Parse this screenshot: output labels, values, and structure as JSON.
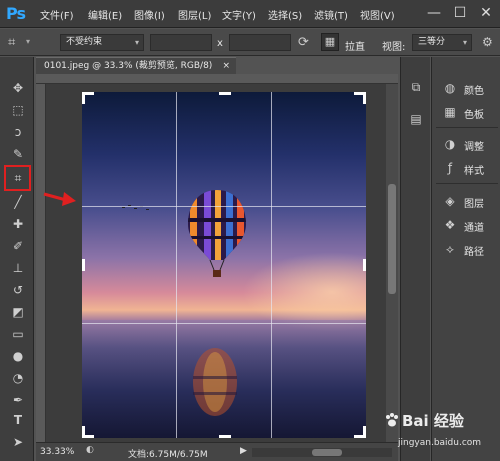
{
  "app": {
    "logo": "Ps"
  },
  "menubar": {
    "items": [
      "文件(F)",
      "编辑(E)",
      "图像(I)",
      "图层(L)",
      "文字(Y)",
      "选择(S)",
      "滤镜(T)",
      "视图(V)"
    ]
  },
  "window_controls": {
    "minimize": "—",
    "maximize": "☐",
    "close": "✕"
  },
  "options": {
    "ratio_select": "不受约束",
    "ratio_separator": "x",
    "straighten_label": "拉直",
    "view_label": "视图:",
    "view_select": "三等分"
  },
  "document": {
    "tab_title": "0101.jpeg @ 33.3% (裁剪预览, RGB/8)",
    "tab_close": "×"
  },
  "statusbar": {
    "zoom": "33.33%",
    "doc_size": "文档:6.75M/6.75M"
  },
  "panels": [
    {
      "icon": "palette-icon",
      "label": "颜色"
    },
    {
      "icon": "swatches-icon",
      "label": "色板"
    },
    {
      "icon": "adjustments-icon",
      "label": "调整"
    },
    {
      "icon": "styles-icon",
      "label": "样式"
    },
    {
      "icon": "layers-icon",
      "label": "图层"
    },
    {
      "icon": "channels-icon",
      "label": "通道"
    },
    {
      "icon": "paths-icon",
      "label": "路径"
    }
  ],
  "watermark": {
    "text": "Bai 经验",
    "url": "jingyan.baidu.com"
  },
  "colors": {
    "accent_red": "#e02020",
    "ps_blue": "#31a8ff"
  }
}
